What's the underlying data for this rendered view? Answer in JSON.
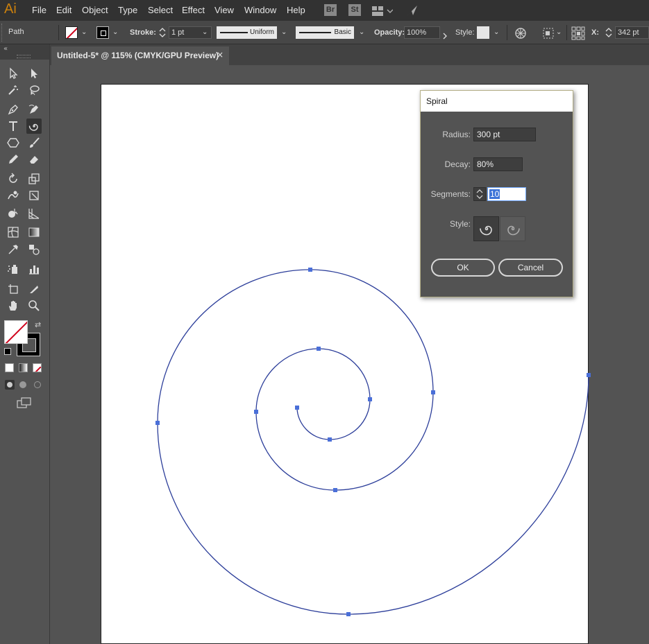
{
  "app": {
    "logo": "Ai"
  },
  "menu": {
    "items": [
      "File",
      "Edit",
      "Object",
      "Type",
      "Select",
      "Effect",
      "View",
      "Window",
      "Help"
    ]
  },
  "menubar_icons": {
    "bridge": "Br",
    "stock": "St"
  },
  "controlbar": {
    "selection_type": "Path",
    "stroke_label": "Stroke:",
    "stroke_weight": "1 pt",
    "profile_uniform": "Uniform",
    "brush_basic": "Basic",
    "opacity_label": "Opacity:",
    "opacity_value": "100%",
    "style_label": "Style:",
    "x_label": "X:",
    "x_value": "342 pt"
  },
  "document_tab": {
    "title": "Untitled-5* @ 115% (CMYK/GPU Preview)",
    "close": "×"
  },
  "spiral_dialog": {
    "title": "Spiral",
    "radius_label": "Radius:",
    "radius_value": "300 pt",
    "decay_label": "Decay:",
    "decay_value": "80%",
    "segments_label": "Segments:",
    "segments_value": "10",
    "style_label": "Style:",
    "ok_label": "OK",
    "cancel_label": "Cancel"
  },
  "colors": {
    "accent_selection": "#3d74d8",
    "path_color": "#2c3e9a",
    "anchor_color": "#4a6fd8",
    "logo_color": "#ff9a00"
  }
}
